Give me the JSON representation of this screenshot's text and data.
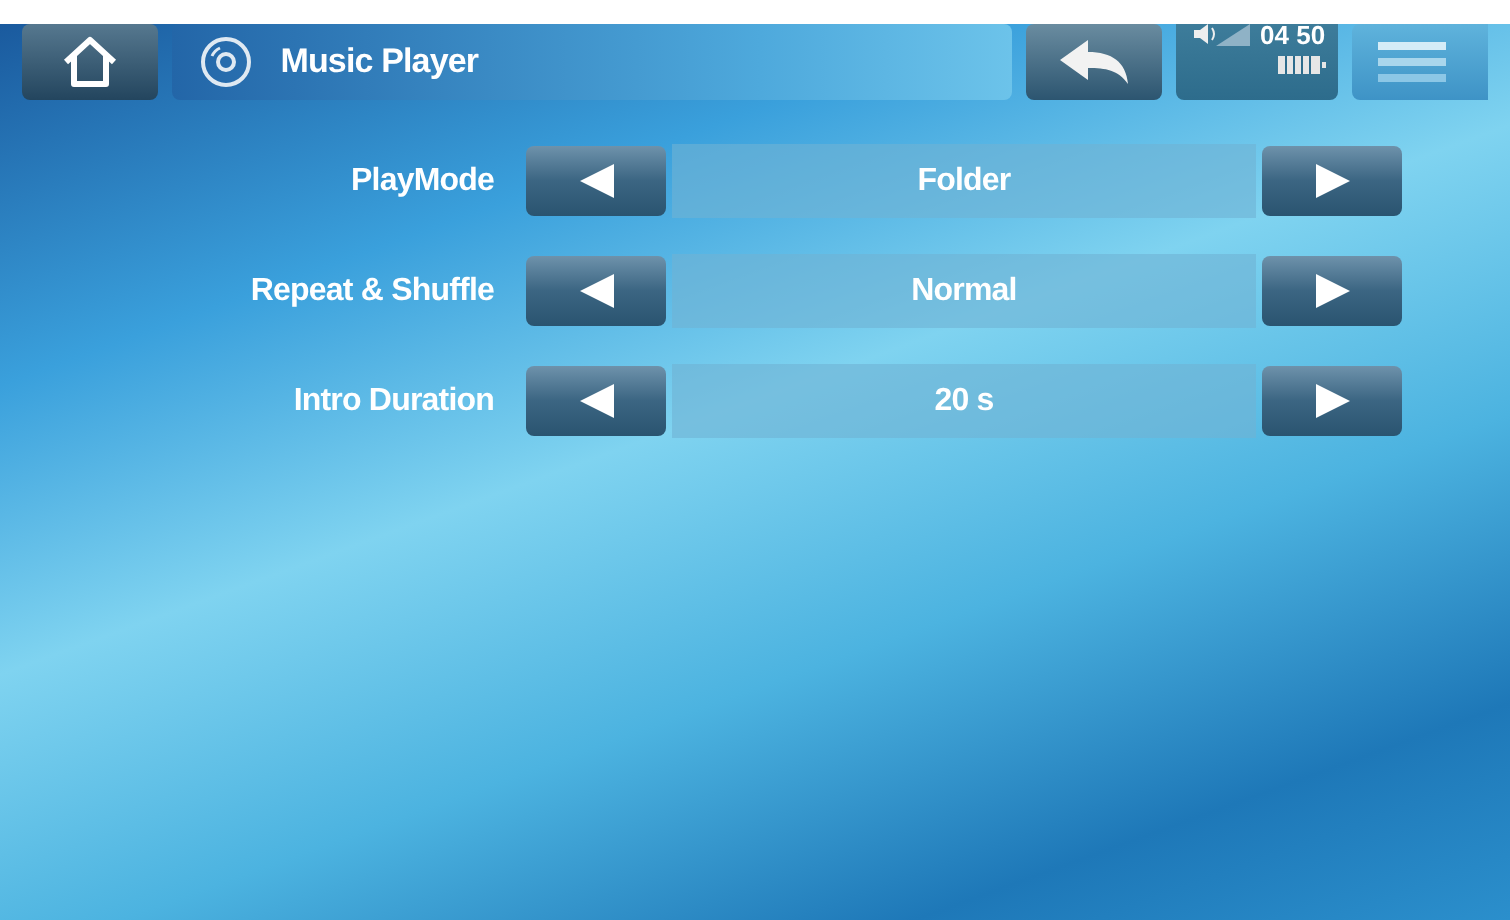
{
  "header": {
    "title": "Music Player",
    "time": "04 50"
  },
  "settings": [
    {
      "label": "PlayMode",
      "value": "Folder"
    },
    {
      "label": "Repeat & Shuffle",
      "value": "Normal"
    },
    {
      "label": "Intro Duration",
      "value": "20 s"
    }
  ]
}
